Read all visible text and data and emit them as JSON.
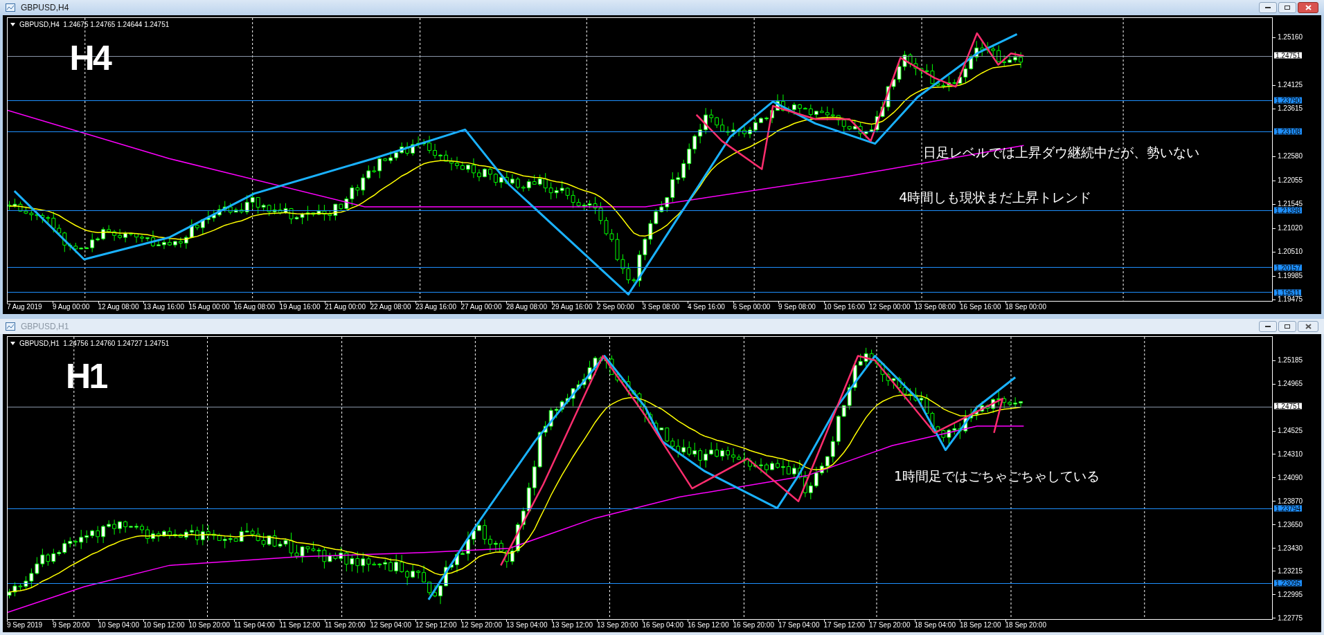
{
  "windows": [
    {
      "title": "GBPUSD,H4",
      "active": true,
      "info": "GBPUSD,H4  1.24675 1.24765 1.24644 1.24751",
      "timeframe_label": "H4",
      "price_ticks": [
        "1.25160",
        "1.24125",
        "1.23615",
        "1.22580",
        "1.22055",
        "1.21545",
        "1.21020",
        "1.20510",
        "1.19985",
        "1.19475"
      ],
      "level_lines": [
        {
          "price": "1.24751",
          "kind": "bid"
        },
        {
          "price": "1.23790",
          "kind": "level"
        },
        {
          "price": "1.23108",
          "kind": "level"
        },
        {
          "price": "1.21398",
          "kind": "level"
        },
        {
          "price": "1.20157",
          "kind": "level"
        },
        {
          "price": "1.19611",
          "kind": "level"
        }
      ],
      "time_labels": [
        "7 Aug 2019",
        "9 Aug 00:00",
        "12 Aug 08:00",
        "13 Aug 16:00",
        "15 Aug 00:00",
        "16 Aug 08:00",
        "19 Aug 16:00",
        "21 Aug 00:00",
        "22 Aug 08:00",
        "23 Aug 16:00",
        "27 Aug 00:00",
        "28 Aug 08:00",
        "29 Aug 16:00",
        "2 Sep 00:00",
        "3 Sep 08:00",
        "4 Sep 16:00",
        "6 Sep 00:00",
        "9 Sep 08:00",
        "10 Sep 16:00",
        "12 Sep 00:00",
        "13 Sep 08:00",
        "16 Sep 16:00",
        "18 Sep 00:00"
      ],
      "notes": [
        "日足レベルでは上昇ダウ継続中だが、勢いない",
        "4時間しも現状まだ上昇トレンド"
      ]
    },
    {
      "title": "GBPUSD,H1",
      "active": false,
      "info": "GBPUSD,H1  1.24756 1.24760 1.24727 1.24751",
      "timeframe_label": "H1",
      "price_ticks": [
        "1.25185",
        "1.24965",
        "1.24525",
        "1.24310",
        "1.24090",
        "1.23870",
        "1.23650",
        "1.23430",
        "1.23215",
        "1.22995",
        "1.22775"
      ],
      "level_lines": [
        {
          "price": "1.24751",
          "kind": "bid"
        },
        {
          "price": "1.23794",
          "kind": "level"
        },
        {
          "price": "1.23095",
          "kind": "level"
        }
      ],
      "time_labels": [
        "9 Sep 2019",
        "9 Sep 20:00",
        "10 Sep 04:00",
        "10 Sep 12:00",
        "10 Sep 20:00",
        "11 Sep 04:00",
        "11 Sep 12:00",
        "11 Sep 20:00",
        "12 Sep 04:00",
        "12 Sep 12:00",
        "12 Sep 20:00",
        "13 Sep 04:00",
        "13 Sep 12:00",
        "13 Sep 20:00",
        "16 Sep 04:00",
        "16 Sep 12:00",
        "16 Sep 20:00",
        "17 Sep 04:00",
        "17 Sep 12:00",
        "17 Sep 20:00",
        "18 Sep 04:00",
        "18 Sep 12:00",
        "18 Sep 20:00"
      ],
      "notes": [
        "1時間足ではごちゃごちゃしている"
      ]
    }
  ]
}
